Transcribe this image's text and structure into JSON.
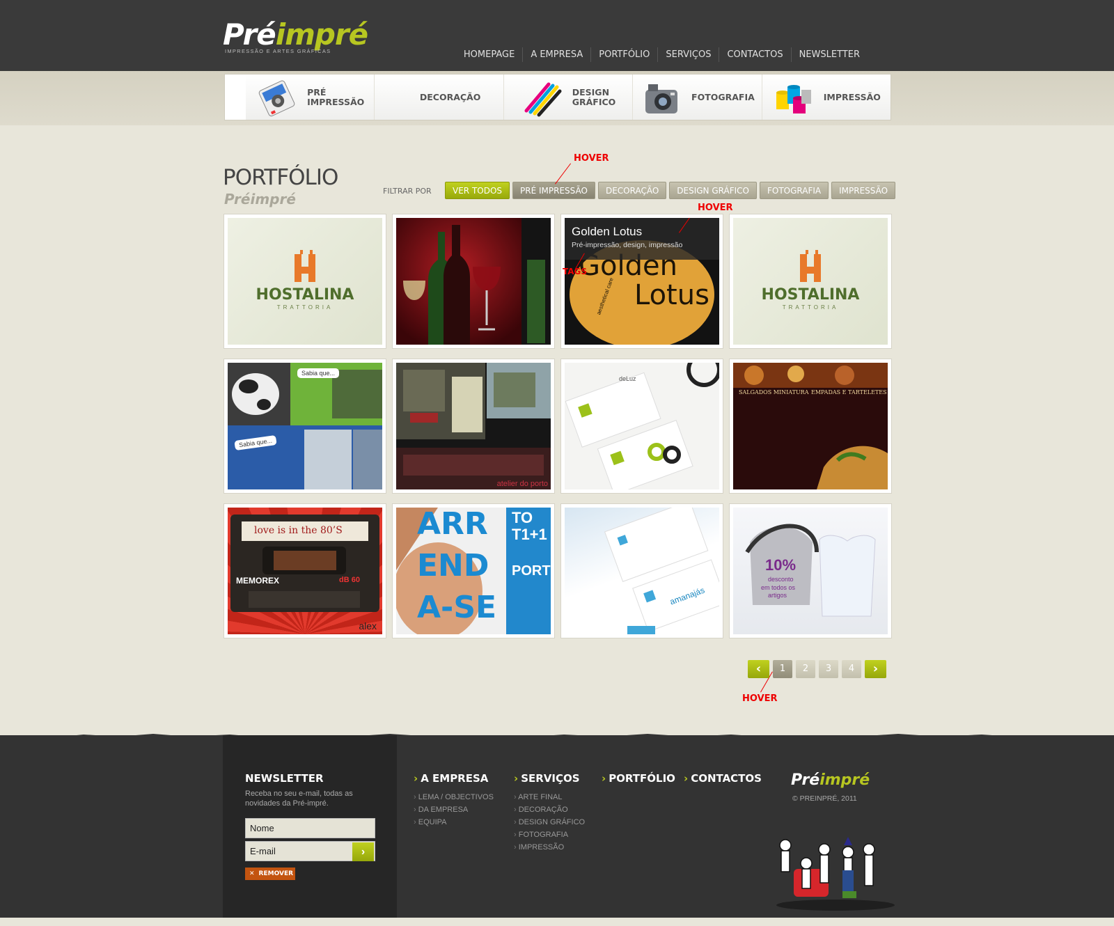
{
  "header": {
    "logo": {
      "part1": "Pré",
      "part2": "impré",
      "tagline": "IMPRESSÃO E ARTES GRÁFICAS"
    },
    "nav": [
      "HOMEPAGE",
      "A EMPRESA",
      "PORTFÓLIO",
      "SERVIÇOS",
      "CONTACTOS",
      "NEWSLETTER"
    ]
  },
  "categories": [
    {
      "label": "PRÉ\nIMPRESSÃO",
      "icon": "pre-press-icon"
    },
    {
      "label": "DECORAÇÃO",
      "icon": "decoration-icon"
    },
    {
      "label": "DESIGN\nGRÁFICO",
      "icon": "graphic-design-icon"
    },
    {
      "label": "FOTOGRAFIA",
      "icon": "camera-icon"
    },
    {
      "label": "IMPRESSÃO",
      "icon": "paint-cans-icon"
    }
  ],
  "portfolio": {
    "title": "PORTFÓLIO",
    "subtitle": "Préimpré",
    "filter_label": "FILTRAR POR",
    "filters": [
      {
        "label": "VER TODOS",
        "state": "active"
      },
      {
        "label": "PRÉ IMPRESSÃO",
        "state": "hover"
      },
      {
        "label": "DECORAÇÃO",
        "state": "normal"
      },
      {
        "label": "DESIGN GRÁFICO",
        "state": "normal"
      },
      {
        "label": "FOTOGRAFIA",
        "state": "normal"
      },
      {
        "label": "IMPRESSÃO",
        "state": "normal"
      }
    ],
    "items": [
      {
        "kind": "hostalina",
        "name": "HOSTALINA",
        "sub": "TRATTORIA"
      },
      {
        "kind": "wine"
      },
      {
        "kind": "lotus",
        "hover_title": "Golden Lotus",
        "hover_tags": "Pré-impressão, design, impressão",
        "art1": "Golden",
        "art2": "Lotus",
        "art3": "aesthetical care"
      },
      {
        "kind": "hostalina",
        "name": "HOSTALINA",
        "sub": "TRATTORIA"
      },
      {
        "kind": "cows",
        "note1": "Sabia que...",
        "note2": "Sabia que..."
      },
      {
        "kind": "interior",
        "caption": "atelier do porto"
      },
      {
        "kind": "cards-green",
        "word": "deLuz"
      },
      {
        "kind": "menu",
        "h1": "SALGADOS MINIATURA",
        "h2": "EMPADAS E TARTELETES"
      },
      {
        "kind": "cassette",
        "label": "love is in the 80’S",
        "brand": "MEMOREX",
        "rating": "dB 60",
        "sig": "alex"
      },
      {
        "kind": "poster",
        "big1": "ARR",
        "big2": "END",
        "big3": "A-SE",
        "to": "TO",
        "t": "T1+1",
        "city": "PORTO"
      },
      {
        "kind": "cards-blue",
        "word": "amanajás"
      },
      {
        "kind": "carseat",
        "promo1": "10%",
        "promo2": "desconto",
        "promo3": "em todos os",
        "promo4": "artigos"
      }
    ],
    "pagination": {
      "prev": "‹",
      "next": "›",
      "pages": [
        "1",
        "2",
        "3",
        "4"
      ],
      "current": "1"
    }
  },
  "annotations": {
    "hover1": "HOVER",
    "hover2": "HOVER",
    "tags": "TAGS",
    "hover3": "HOVER"
  },
  "footer": {
    "newsletter": {
      "title": "NEWSLETTER",
      "desc": "Receba no seu e-mail, todas as novidades da Pré-impré.",
      "name_placeholder": "Nome",
      "email_placeholder": "E-mail",
      "remove": "REMOVER"
    },
    "columns": [
      {
        "title": "A EMPRESA",
        "items": [
          "LEMA / OBJECTIVOS",
          "DA EMPRESA",
          "EQUIPA"
        ]
      },
      {
        "title": "SERVIÇOS",
        "items": [
          "ARTE FINAL",
          "DECORAÇÃO",
          "DESIGN GRÁFICO",
          "FOTOGRAFIA",
          "IMPRESSÃO"
        ]
      },
      {
        "title": "PORTFÓLIO",
        "items": []
      },
      {
        "title": "CONTACTOS",
        "items": []
      }
    ],
    "logo": {
      "part1": "Pré",
      "part2": "impré"
    },
    "copyright": "© PREINPRÉ, 2011"
  },
  "colors": {
    "accent": "#b7c621",
    "header": "#3a3a3a",
    "background": "#e8e6da",
    "annotation": "#ee0000",
    "remove": "#c35410"
  }
}
